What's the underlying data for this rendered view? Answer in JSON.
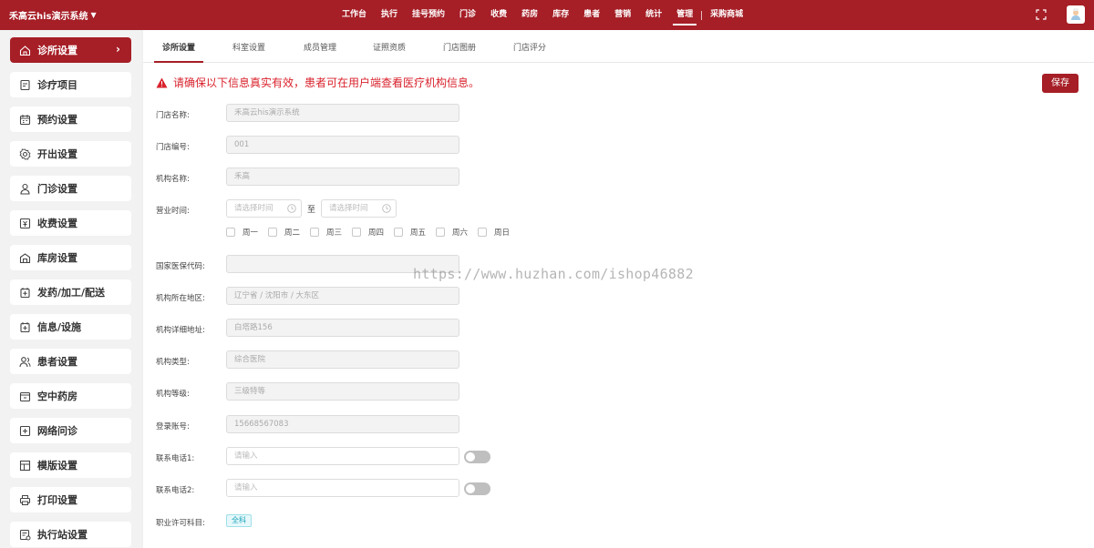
{
  "topbar": {
    "brand": "禾高云his演示系统",
    "nav": [
      "工作台",
      "执行",
      "挂号预约",
      "门诊",
      "收费",
      "药房",
      "库存",
      "患者",
      "营销",
      "统计",
      "管理",
      "采购商城"
    ],
    "active_nav": "管理"
  },
  "sidebar": {
    "items": [
      {
        "label": "诊所设置",
        "icon": "home-icon"
      },
      {
        "label": "诊疗项目",
        "icon": "clipboard-icon"
      },
      {
        "label": "预约设置",
        "icon": "calendar-icon"
      },
      {
        "label": "开出设置",
        "icon": "gear-icon"
      },
      {
        "label": "门诊设置",
        "icon": "user-icon"
      },
      {
        "label": "收费设置",
        "icon": "money-icon"
      },
      {
        "label": "库房设置",
        "icon": "warehouse-icon"
      },
      {
        "label": "发药/加工/配送",
        "icon": "medicine-icon"
      },
      {
        "label": "信息/设施",
        "icon": "info-icon"
      },
      {
        "label": "患者设置",
        "icon": "patients-icon"
      },
      {
        "label": "空中药房",
        "icon": "pharmacy-icon"
      },
      {
        "label": "网络问诊",
        "icon": "online-icon"
      },
      {
        "label": "模版设置",
        "icon": "template-icon"
      },
      {
        "label": "打印设置",
        "icon": "printer-icon"
      },
      {
        "label": "执行站设置",
        "icon": "station-icon"
      }
    ]
  },
  "tabs": [
    "诊所设置",
    "科室设置",
    "成员管理",
    "证照资质",
    "门店图册",
    "门店评分"
  ],
  "notice": "请确保以下信息真实有效，患者可在用户端查看医疗机构信息。",
  "save_label": "保存",
  "form": {
    "store_name": {
      "label": "门店名称:",
      "value": "禾高云his演示系统"
    },
    "store_code": {
      "label": "门店编号:",
      "value": "001"
    },
    "org_name": {
      "label": "机构名称:",
      "value": "禾高"
    },
    "business_hours": {
      "label": "营业时间:",
      "start_placeholder": "请选择时间",
      "end_placeholder": "请选择时间",
      "to": "至",
      "weekdays": [
        "周一",
        "周二",
        "周三",
        "周四",
        "周五",
        "周六",
        "周日"
      ]
    },
    "insurance_code": {
      "label": "国家医保代码:",
      "value": ""
    },
    "region": {
      "label": "机构所在地区:",
      "value": "辽宁省 / 沈阳市 / 大东区"
    },
    "address": {
      "label": "机构详细地址:",
      "value": "白塔路156"
    },
    "org_type": {
      "label": "机构类型:",
      "value": "综合医院"
    },
    "org_level": {
      "label": "机构等级:",
      "value": "三级特等"
    },
    "login_account": {
      "label": "登录账号:",
      "value": "15668567083"
    },
    "phone1": {
      "label": "联系电话1:",
      "placeholder": "请输入",
      "toggle_on": false
    },
    "phone2": {
      "label": "联系电话2:",
      "placeholder": "请输入",
      "toggle_on": false
    },
    "license_scope": {
      "label": "职业许可科目:",
      "tag": "全科"
    }
  },
  "watermark": "https://www.huzhan.com/ishop46882",
  "colors": {
    "brand": "#a61e26",
    "warning": "#d9222c",
    "tag": "#1aa3b8"
  }
}
